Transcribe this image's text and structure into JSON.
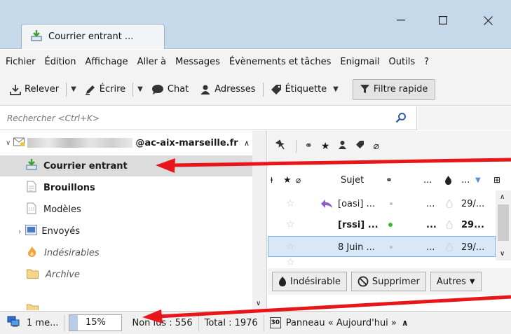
{
  "window": {
    "tab_title": "Courrier entrant ..."
  },
  "menu": [
    "Fichier",
    "Édition",
    "Affichage",
    "Aller à",
    "Messages",
    "Évènements et tâches",
    "Enigmail",
    "Outils",
    "?"
  ],
  "toolbar": {
    "get_mail": "Relever",
    "write": "Écrire",
    "chat": "Chat",
    "address_book": "Adresses",
    "tag": "Étiquette",
    "quick_filter": "Filtre rapide"
  },
  "search": {
    "placeholder": "Rechercher <Ctrl+K>"
  },
  "folders": {
    "account": "@ac-aix-marseille.fr",
    "items": [
      {
        "label": "Courrier entrant",
        "selected": true,
        "bold": true
      },
      {
        "label": "Brouillons",
        "bold": true
      },
      {
        "label": "Modèles"
      },
      {
        "label": "Envoyés"
      },
      {
        "label": "Indésirables",
        "italic": true
      },
      {
        "label": "Archive",
        "italic": true
      }
    ]
  },
  "message_list": {
    "columns": {
      "subject": "Sujet",
      "date": "..."
    },
    "rows": [
      {
        "subject": "[oasi] ...",
        "sender": "...",
        "date": "29/...",
        "unread": false,
        "replied": true,
        "dot": "gray"
      },
      {
        "subject": "[rssi] ...",
        "sender": "...",
        "date": "29...",
        "unread": true,
        "dot": "green"
      },
      {
        "subject": "8 Juin ...",
        "sender": "...",
        "date": "29/...",
        "unread": false,
        "selected": true,
        "dot": "gray"
      }
    ]
  },
  "actions": {
    "junk": "Indésirable",
    "delete": "Supprimer",
    "other": "Autres"
  },
  "status": {
    "message": "1 me...",
    "progress_percent": 15,
    "progress_text": "15%",
    "unread": "Non lus : 556",
    "total": "Total : 1976",
    "today_pane": "Panneau « Aujourd'hui »",
    "calendar_day": "30"
  },
  "colors": {
    "accent": "#c5d9ea",
    "selection": "#d9e8f7",
    "arrow": "#e8161b",
    "green": "#3cb83c"
  }
}
